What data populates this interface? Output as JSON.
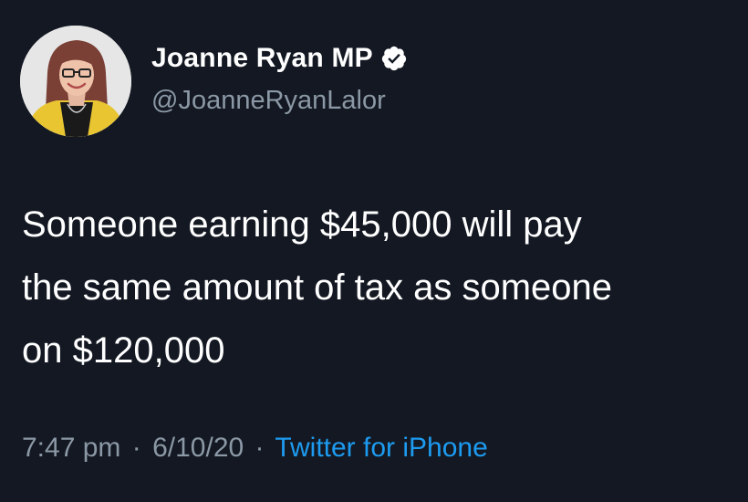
{
  "author": {
    "display_name": "Joanne Ryan MP",
    "handle": "@JoanneRyanLalor",
    "verified_icon": "verified-badge-icon",
    "avatar_icon": "profile-photo"
  },
  "tweet": {
    "lines": [
      "Someone earning $45,000 will pay",
      "the same amount of tax as someone",
      "on $120,000"
    ]
  },
  "meta": {
    "time": "7:47 pm",
    "separator": "·",
    "date": "6/10/20",
    "source": "Twitter for iPhone"
  },
  "colors": {
    "background": "#131822",
    "text": "#ffffff",
    "secondary": "#8b98a5",
    "link": "#1d9bf0"
  }
}
